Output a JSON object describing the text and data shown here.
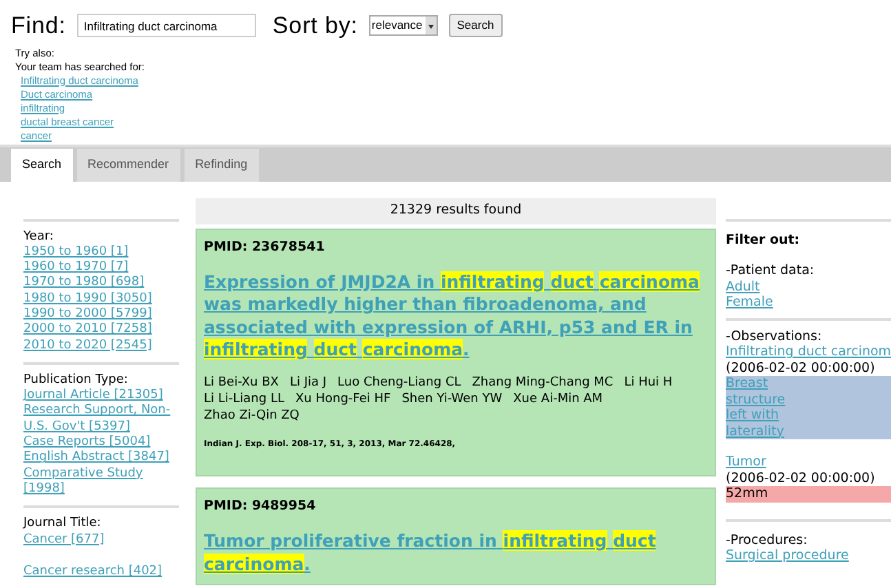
{
  "search": {
    "label": "Find:",
    "value": "Infiltrating duct carcinoma",
    "sort_label": "Sort by:",
    "sort_value": "relevance",
    "button": "Search"
  },
  "suggestions": {
    "title": "Try also:",
    "subtitle": "Your team has searched for:",
    "items": [
      "Infiltrating duct carcinoma",
      "Duct carcinoma",
      "infiltrating",
      "ductal breast cancer",
      "cancer"
    ]
  },
  "tabs": [
    {
      "label": "Search",
      "selected": true
    },
    {
      "label": "Recommender",
      "selected": false
    },
    {
      "label": "Refinding",
      "selected": false
    }
  ],
  "facets": [
    {
      "title": "Year:",
      "items": [
        "1950 to 1960 [1]",
        "1960 to 1970 [7]",
        "1970 to 1980 [698]",
        "1980 to 1990 [3050]",
        "1990 to 2000 [5799]",
        "2000 to 2010 [7258]",
        "2010 to 2020 [2545]"
      ]
    },
    {
      "title": "Publication Type:",
      "items": [
        "Journal Article [21305]",
        "Research Support, Non-U.S. Gov't [5397]",
        "Case Reports [5004]",
        "English Abstract [3847]",
        "Comparative Study [1998]"
      ]
    },
    {
      "title": "Journal Title:",
      "items": [
        "Cancer [677]",
        "Cancer research [402]"
      ]
    }
  ],
  "results_count": "21329 results found",
  "results": [
    {
      "pmid": "PMID: 23678541",
      "title": [
        {
          "text": "Expression of JMJD2A in",
          "highlight": false
        },
        {
          "text": "infiltrating",
          "highlight": true
        },
        {
          "text": "duct",
          "highlight": true
        },
        {
          "text": "carcinoma",
          "highlight": true
        },
        {
          "text": "was markedly higher than fibroadenoma, and associated with expression of ARHI, p53 and ER in",
          "highlight": false
        },
        {
          "text": "infiltrating",
          "highlight": true
        },
        {
          "text": "duct",
          "highlight": true
        },
        {
          "text": "carcinoma",
          "highlight": true
        },
        {
          "text": ".",
          "highlight": false,
          "space_before": false
        }
      ],
      "authors": [
        "Li Bei-Xu BX",
        "Li Jia J",
        "Luo Cheng-Liang CL",
        "Zhang Ming-Chang MC",
        "Li Hui H",
        "Li Li-Liang LL",
        "Xu Hong-Fei HF",
        "Shen Yi-Wen YW",
        "Xue Ai-Min AM",
        "Zhao Zi-Qin ZQ"
      ],
      "citation": "Indian J. Exp. Biol. 208-17, 51, 3, 2013, Mar 72.46428,"
    },
    {
      "pmid": "PMID: 9489954",
      "title": [
        {
          "text": "Tumor proliferative fraction in",
          "highlight": false
        },
        {
          "text": "infiltrating",
          "highlight": true
        },
        {
          "text": "duct",
          "highlight": true
        },
        {
          "text": "carcinoma",
          "highlight": true
        },
        {
          "text": ".",
          "highlight": false,
          "space_before": false
        }
      ]
    }
  ],
  "filter": {
    "title": "Filter out:",
    "patient_title": "-Patient data:",
    "patient_items": [
      "Adult",
      "Female"
    ],
    "observations_title": "-Observations:",
    "observations": [
      {
        "name": "Infiltrating duct carcinom",
        "date": "(2006-02-02 00:00:00)",
        "value": "Breast structure left with laterality",
        "kind": "link",
        "color": "#b0c4de"
      },
      {
        "name": "Tumor",
        "date": "(2006-02-02 00:00:00)",
        "value": "52mm",
        "kind": "text",
        "color": "#f4a9a8"
      }
    ],
    "procedures_title": "-Procedures:",
    "procedure_items": [
      "Surgical procedure"
    ]
  }
}
